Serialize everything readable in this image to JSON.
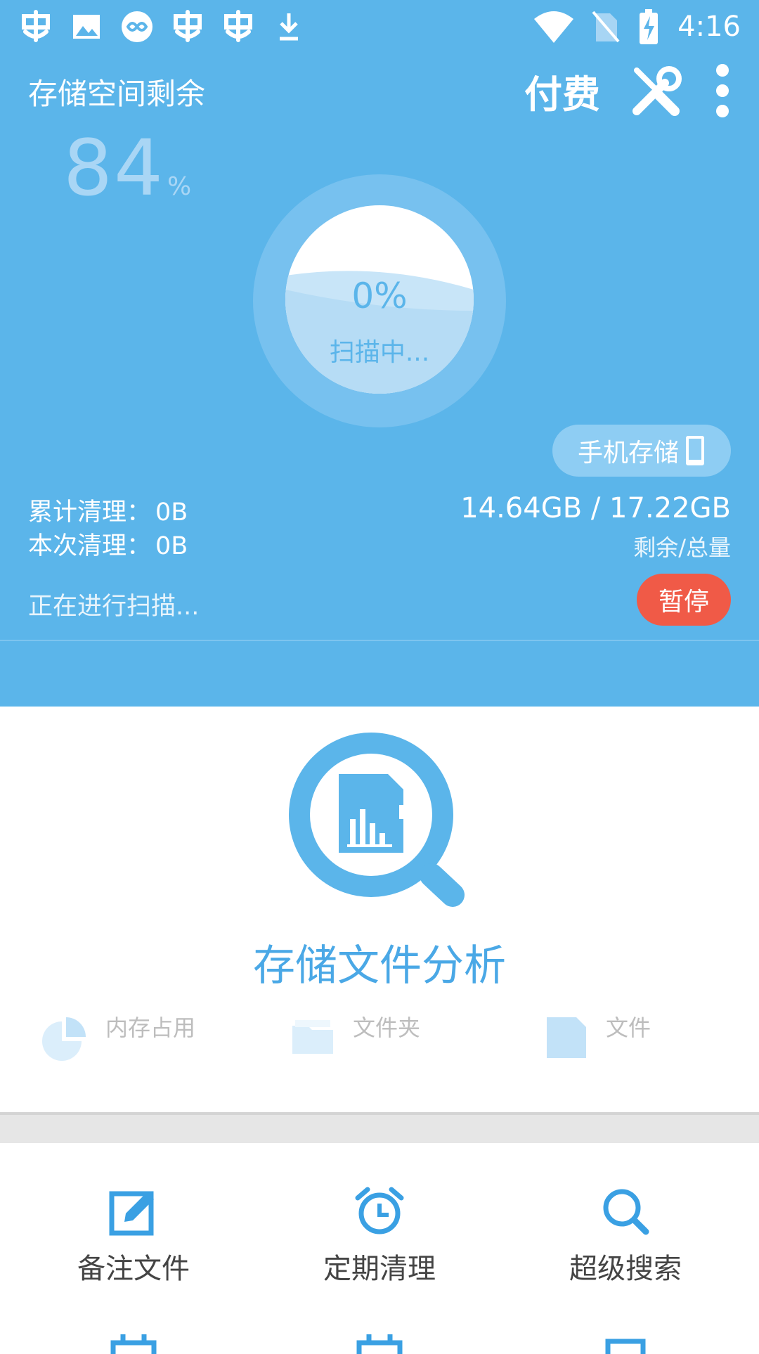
{
  "status_bar": {
    "time": "4:16",
    "left_icons": [
      "app-bug-icon",
      "image-icon",
      "infinity-icon",
      "app-bug-icon",
      "app-bug-icon",
      "download-icon"
    ],
    "right_icons": [
      "wifi-icon",
      "no-sim-icon",
      "battery-charging-icon"
    ]
  },
  "header": {
    "storage_remaining_label": "存储空间剩余",
    "remaining_percent": "84",
    "percent_sign": "%",
    "pay_label": "付费",
    "scan_progress": "0%",
    "scan_status": "扫描中...",
    "storage_chip_label": "手机存储",
    "cleaned_total_label": "累计清理：",
    "cleaned_total_value": "0B",
    "cleaned_this_label": "本次清理：",
    "cleaned_this_value": "0B",
    "storage_size": "14.64GB / 17.22GB",
    "storage_size_caption": "剩余/总量",
    "scanning_text": "正在进行扫描...",
    "pause_label": "暂停"
  },
  "analysis": {
    "title": "存储文件分析",
    "stats": [
      {
        "label": "内存占用",
        "icon": "pie-chart-icon"
      },
      {
        "label": "文件夹",
        "icon": "folder-icon"
      },
      {
        "label": "文件",
        "icon": "file-icon"
      }
    ]
  },
  "tools": [
    {
      "label": "备注文件",
      "icon": "edit-note-icon"
    },
    {
      "label": "定期清理",
      "icon": "alarm-clock-icon"
    },
    {
      "label": "超级搜索",
      "icon": "search-icon"
    }
  ],
  "colors": {
    "header_bg": "#5bb5ea",
    "accent": "#4aa8e6",
    "pause_bg": "#f05a47"
  }
}
